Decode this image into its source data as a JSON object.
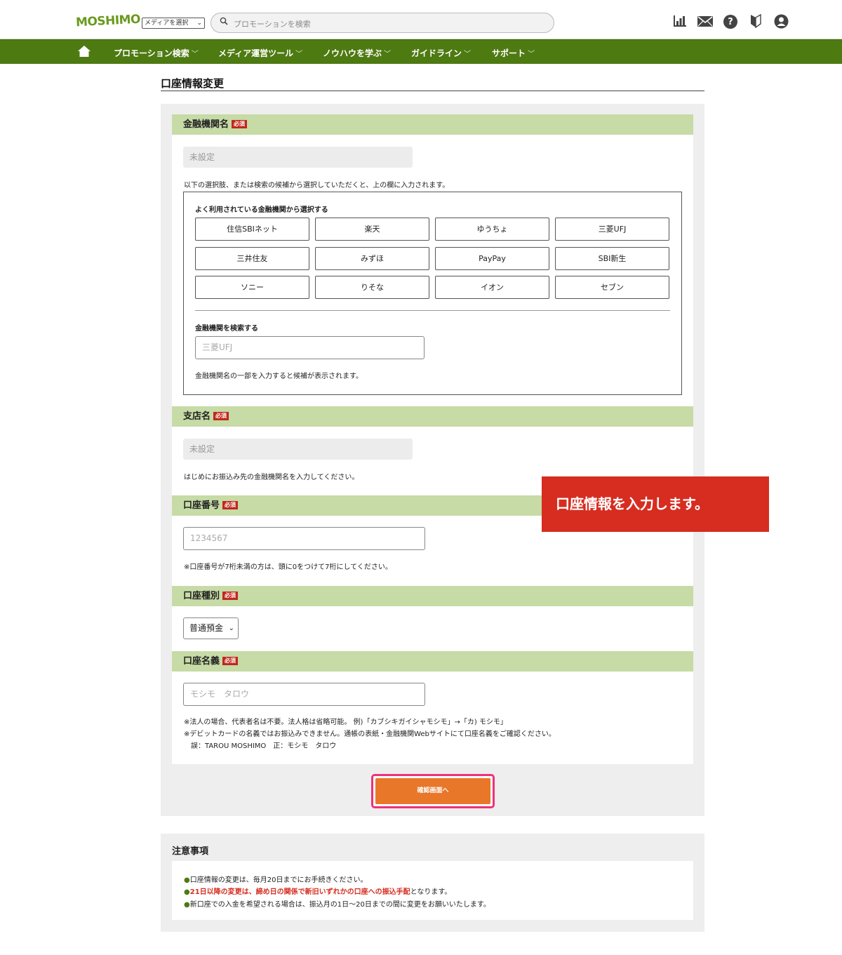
{
  "header": {
    "logo": "MOSHIMO",
    "media_select": "メディアを選択",
    "search_placeholder": "プロモーションを検索",
    "icons": [
      "chart-icon",
      "mail-icon",
      "help-icon",
      "beginner-icon",
      "account-icon"
    ]
  },
  "nav": {
    "items": [
      "プロモーション検索",
      "メディア運営ツール",
      "ノウハウを学ぶ",
      "ガイドライン",
      "サポート"
    ]
  },
  "page": {
    "title": "口座情報変更"
  },
  "form": {
    "required_badge": "必須",
    "bank": {
      "label": "金融機関名",
      "value": "未設定",
      "instruction": "以下の選択肢、または検索の候補から選択していただくと、上の欄に入力されます。",
      "popular_title": "よく利用されている金融機関から選択する",
      "popular_banks": [
        "住信SBIネット",
        "楽天",
        "ゆうちょ",
        "三菱UFJ",
        "三井住友",
        "みずほ",
        "PayPay",
        "SBI新生",
        "ソニー",
        "りそな",
        "イオン",
        "セブン"
      ],
      "search_label": "金融機関を検索する",
      "search_placeholder": "三菱UFJ",
      "search_hint": "金融機関名の一部を入力すると候補が表示されます。"
    },
    "branch": {
      "label": "支店名",
      "value": "未設定",
      "hint": "はじめにお振込み先の金融機関名を入力してください。"
    },
    "account_number": {
      "label": "口座番号",
      "placeholder": "1234567",
      "hint": "※口座番号が7桁未満の方は、頭に0をつけて7桁にしてください。"
    },
    "account_type": {
      "label": "口座種別",
      "selected": "普通預金"
    },
    "account_name": {
      "label": "口座名義",
      "placeholder": "モシモ　タロウ",
      "hints": [
        "※法人の場合、代表者名は不要。法人格は省略可能。 例)「カブシキガイシャモシモ」→「カ) モシモ」",
        "※デビットカードの名義ではお振込みできません。通帳の表紙・金融機関Webサイトにて口座名義をご確認ください。",
        "　誤：TAROU MOSHIMO　正：モシモ　タロウ"
      ]
    },
    "submit": "確認画面へ"
  },
  "callout": {
    "text": "口座情報を入力します。"
  },
  "notice": {
    "title": "注意事項",
    "lines": [
      "口座情報の変更は、毎月20日までにお手続きください。",
      "21日以降の変更は、締め日の関係で新旧いずれかの口座への振込手配",
      "となります。",
      "新口座での入金を希望される場合は、振込月の1日〜20日までの間に変更をお願いいたします。"
    ]
  },
  "colors": {
    "nav_green": "#4e7a12",
    "section_green": "#c6dba5",
    "required_red": "#c0271c",
    "submit_orange": "#e8772a",
    "highlight_pink": "#f0307a",
    "callout_red": "#d62d20"
  }
}
